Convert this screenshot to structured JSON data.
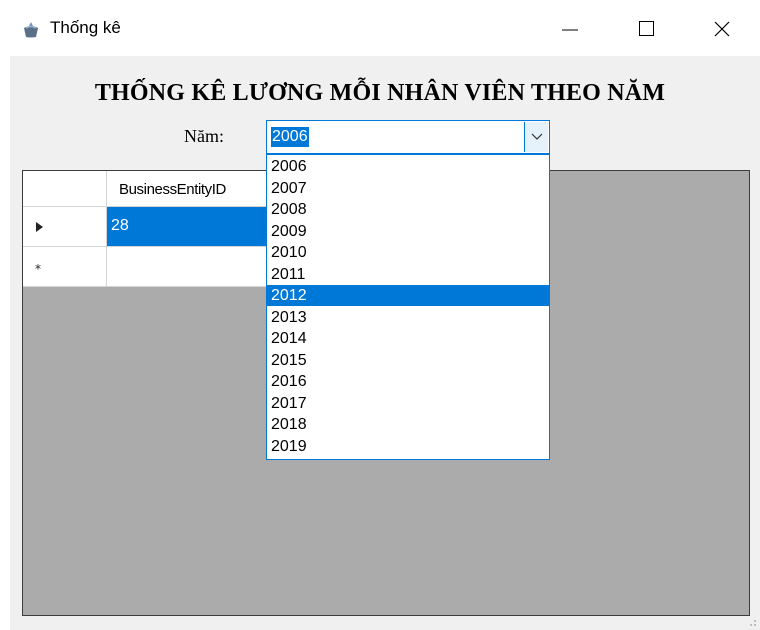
{
  "window": {
    "title": "Thống kê"
  },
  "form": {
    "heading": "THỐNG KÊ LƯƠNG MỖI NHÂN VIÊN THEO NĂM",
    "year_label": "Năm:",
    "year_selected": "2006",
    "year_options": [
      "2006",
      "2007",
      "2008",
      "2009",
      "2010",
      "2011",
      "2012",
      "2013",
      "2014",
      "2015",
      "2016",
      "2017",
      "2018",
      "2019"
    ],
    "highlighted_option": "2012"
  },
  "grid": {
    "columns": [
      "BusinessEntityID"
    ],
    "rows": [
      {
        "BusinessEntityID": "28",
        "row_indicator": "current-row-arrow-icon"
      },
      {
        "BusinessEntityID": "",
        "row_indicator": "new-row-asterisk-icon"
      }
    ]
  },
  "colors": {
    "accent": "#0078d7",
    "grid_background": "#ababab",
    "client_background": "#f0f0f0"
  }
}
